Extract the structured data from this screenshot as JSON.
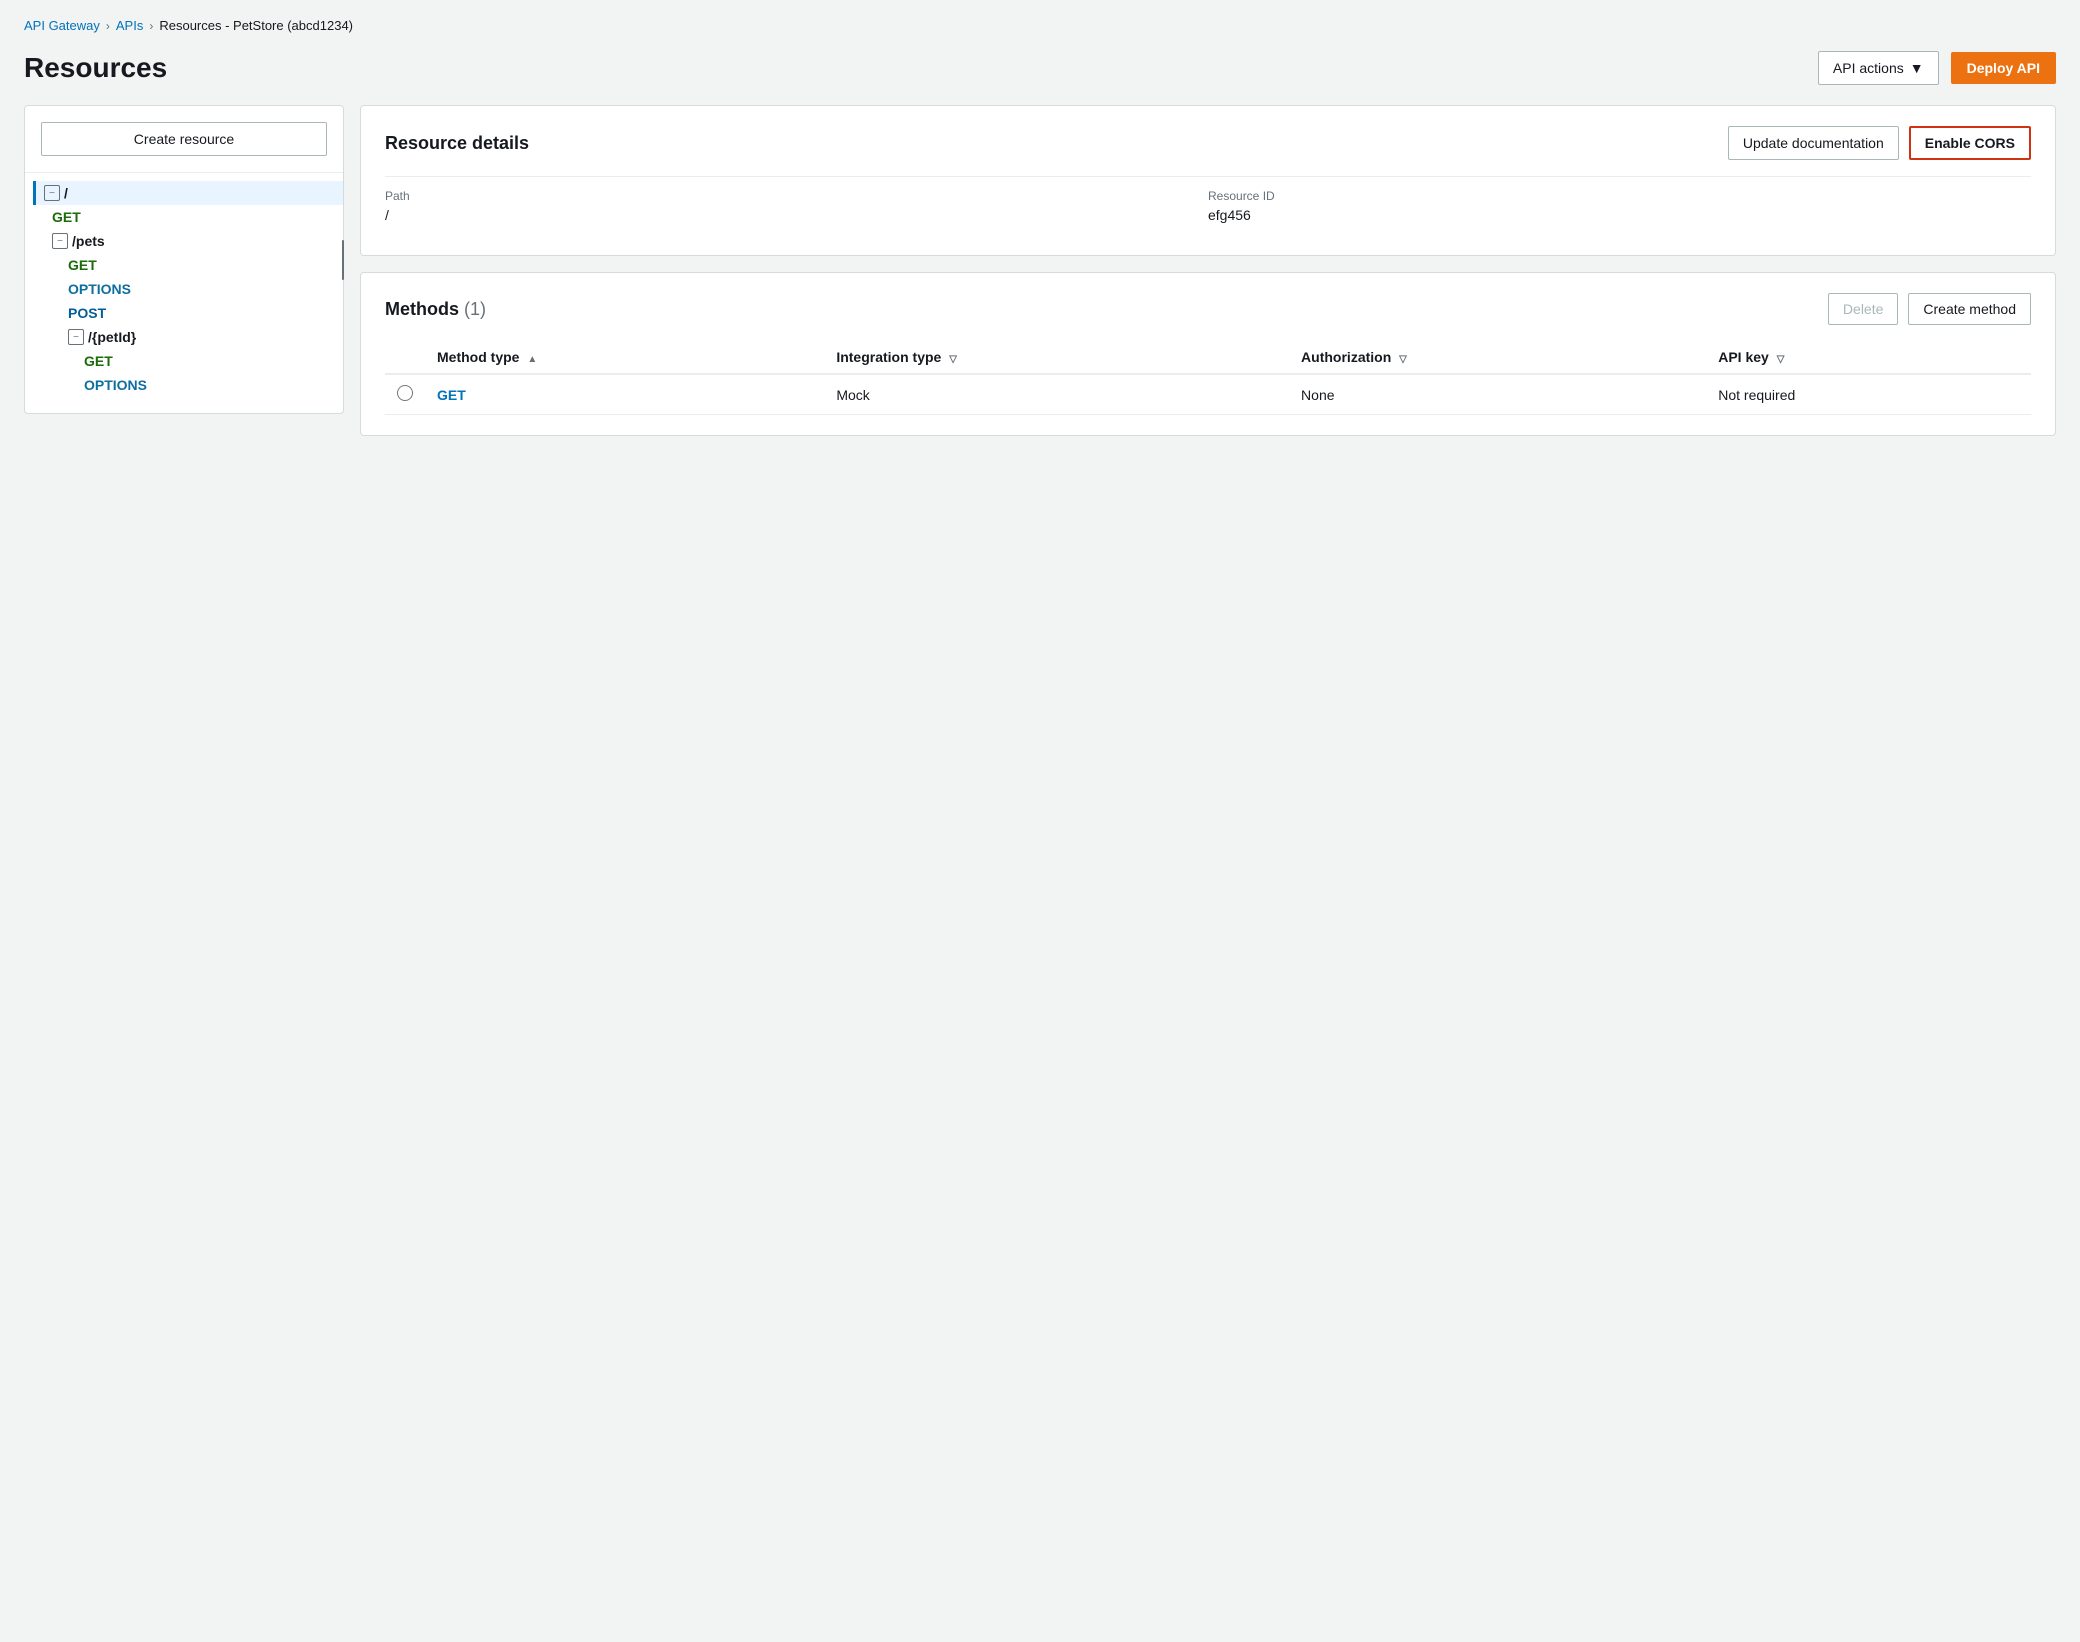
{
  "breadcrumb": {
    "items": [
      {
        "label": "API Gateway",
        "href": "#"
      },
      {
        "label": "APIs",
        "href": "#"
      },
      {
        "label": "Resources - PetStore (abcd1234)",
        "href": null
      }
    ],
    "separators": [
      ">",
      ">"
    ]
  },
  "page": {
    "title": "Resources"
  },
  "header": {
    "api_actions_label": "API actions",
    "deploy_label": "Deploy API"
  },
  "sidebar": {
    "create_resource_label": "Create resource",
    "tree": [
      {
        "id": "root",
        "type": "path",
        "label": "/",
        "indent": 0,
        "toggle": "−",
        "selected": true
      },
      {
        "id": "get-root",
        "type": "method",
        "label": "GET",
        "indent": 1,
        "method_type": "get"
      },
      {
        "id": "pets",
        "type": "path",
        "label": "/pets",
        "indent": 1,
        "toggle": "−"
      },
      {
        "id": "get-pets",
        "type": "method",
        "label": "GET",
        "indent": 2,
        "method_type": "get"
      },
      {
        "id": "options-pets",
        "type": "method",
        "label": "OPTIONS",
        "indent": 2,
        "method_type": "options"
      },
      {
        "id": "post-pets",
        "type": "method",
        "label": "POST",
        "indent": 2,
        "method_type": "post"
      },
      {
        "id": "petId",
        "type": "path",
        "label": "/{petId}",
        "indent": 2,
        "toggle": "−"
      },
      {
        "id": "get-petId",
        "type": "method",
        "label": "GET",
        "indent": 3,
        "method_type": "get"
      },
      {
        "id": "options-petId",
        "type": "method",
        "label": "OPTIONS",
        "indent": 3,
        "method_type": "options"
      }
    ]
  },
  "resource_details": {
    "title": "Resource details",
    "update_doc_label": "Update documentation",
    "enable_cors_label": "Enable CORS",
    "path_label": "Path",
    "path_value": "/",
    "resource_id_label": "Resource ID",
    "resource_id_value": "efg456"
  },
  "methods": {
    "title": "Methods",
    "count": "(1)",
    "delete_label": "Delete",
    "create_method_label": "Create method",
    "columns": [
      {
        "label": "Method type",
        "sortable": true,
        "sort_dir": "asc"
      },
      {
        "label": "Integration type",
        "sortable": true,
        "sort_dir": "desc"
      },
      {
        "label": "Authorization",
        "sortable": true,
        "sort_dir": "desc"
      },
      {
        "label": "API key",
        "sortable": true,
        "sort_dir": "desc"
      }
    ],
    "rows": [
      {
        "selected": false,
        "method": "GET",
        "integration_type": "Mock",
        "authorization": "None",
        "api_key": "Not required"
      }
    ]
  }
}
